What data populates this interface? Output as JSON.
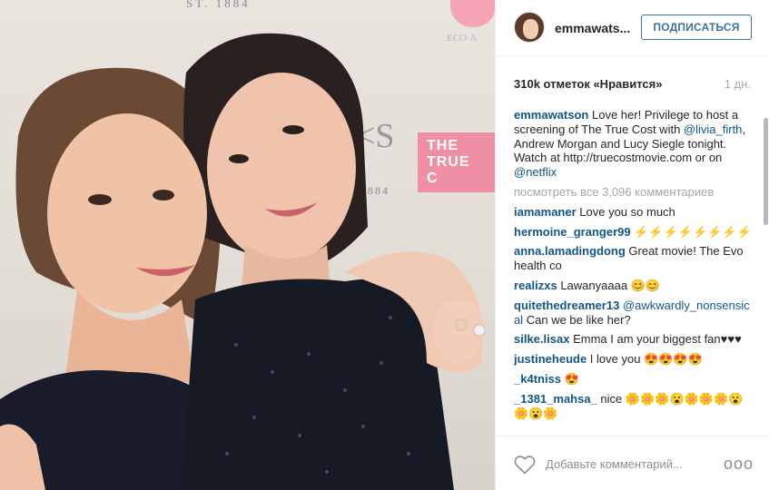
{
  "photo": {
    "bg_texts": {
      "est": "ST. 1884",
      "est2": "1884",
      "eco": "ECO·A",
      "ks": "<S",
      "pink_word": "THE TRUE C"
    }
  },
  "header": {
    "username": "emmawats...",
    "follow_label": "ПОДПИСАТЬСЯ"
  },
  "stats": {
    "likes": "310k отметок «Нравится»",
    "time": "1 дн."
  },
  "caption": {
    "user": "emmawatson",
    "text1": " Love her! Privilege to host a screening of The True Cost with ",
    "mention1": "@livia_firth",
    "text2": ", Andrew Morgan and Lucy Siegle tonight. Watch at http://truecostmovie.com or on ",
    "mention2": "@netflix"
  },
  "view_all": "посмотреть все 3,096 комментариев",
  "comments": [
    {
      "user": "iamamaner",
      "text": " Love you so much"
    },
    {
      "user": "hermoine_granger99",
      "text": " ⚡⚡⚡⚡⚡⚡⚡⚡"
    },
    {
      "user": "anna.lamadingdong",
      "text": " Great movie! The Evo health co"
    },
    {
      "user": "realizxs",
      "text": " Lawanyaaaa 😊😊"
    },
    {
      "user": "quitethedreamer13",
      "mention": " @awkwardly_nonsensical",
      "text": " Can we be like her?"
    },
    {
      "user": "silke.lisax",
      "text": " Emma I am your biggest fan♥♥♥"
    },
    {
      "user": "justineheude",
      "text": " I love you 😍😍😍😍"
    },
    {
      "user": "_k4tniss",
      "text": " 😍"
    },
    {
      "user": "_1381_mahsa_",
      "text": " nice 🌼🌼🌼😮🌼🌼🌼😮🌼😮🌼"
    }
  ],
  "footer": {
    "add_comment_placeholder": "Добавьте комментарий...",
    "more": "ooo"
  },
  "colors": {
    "link": "#125688",
    "follow": "#3f729b",
    "accent_pink": "#ef8fa6"
  }
}
